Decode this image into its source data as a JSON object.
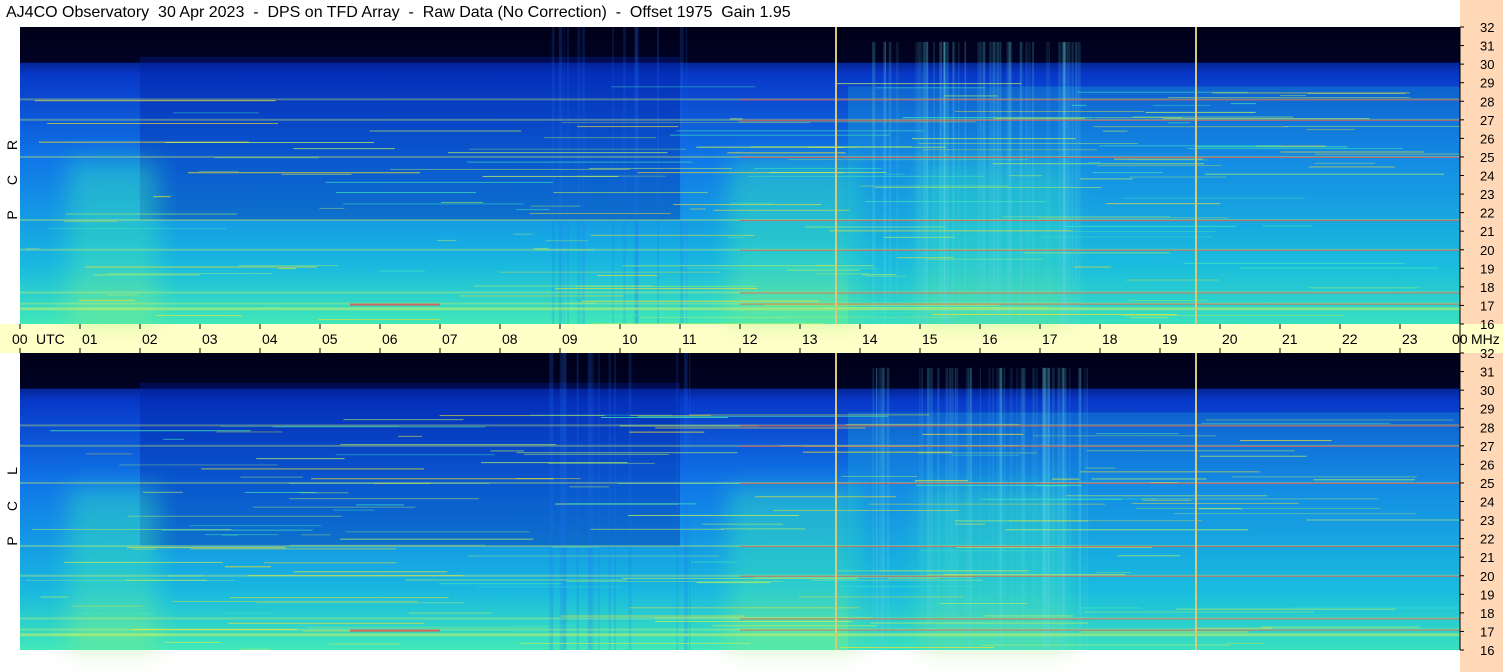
{
  "title": "AJ4CO Observatory  30 Apr 2023  -  DPS on TFD Array  -  Raw Data (No Correction)  -  Offset 1975  Gain 1.95",
  "colors": {
    "background": "#ffffff",
    "time_axis_band": "#ffffc8",
    "freq_axis_band": "#ffd8b8",
    "marker_line": "#d8c878",
    "colormap": [
      "#000018",
      "#001060",
      "#0838c8",
      "#1078e8",
      "#18b8e0",
      "#40e8b8",
      "#b8f060",
      "#f0e030",
      "#f04848"
    ]
  },
  "chart_data": {
    "type": "heatmap",
    "panels": [
      {
        "label": "R C P",
        "letters": [
          "R",
          "C",
          "P"
        ]
      },
      {
        "label": "L C P",
        "letters": [
          "L",
          "C",
          "P"
        ]
      }
    ],
    "x": {
      "unit": "UTC",
      "tick_labels": [
        "00",
        "01",
        "02",
        "03",
        "04",
        "05",
        "06",
        "07",
        "08",
        "09",
        "10",
        "11",
        "12",
        "13",
        "14",
        "15",
        "16",
        "17",
        "18",
        "19",
        "20",
        "21",
        "22",
        "23",
        "00"
      ],
      "unit_label": "UTC",
      "range_hours": [
        0,
        24
      ]
    },
    "y": {
      "unit": "MHz",
      "tick_labels": [
        "32",
        "31",
        "30",
        "29",
        "28",
        "27",
        "26",
        "25",
        "24",
        "23",
        "22",
        "21",
        "20",
        "19",
        "18",
        "17",
        "16"
      ],
      "range_mhz": [
        16,
        32
      ]
    },
    "marker_times_utc": [
      13.6,
      19.6
    ],
    "interference_bands_mhz": [
      17.1,
      17.7,
      20.0,
      21.6,
      25.0,
      27.0,
      28.1
    ],
    "brightening_hours": [
      [
        0.8,
        2.3
      ],
      [
        15.0,
        17.5
      ],
      [
        11.8,
        14.0
      ]
    ]
  }
}
